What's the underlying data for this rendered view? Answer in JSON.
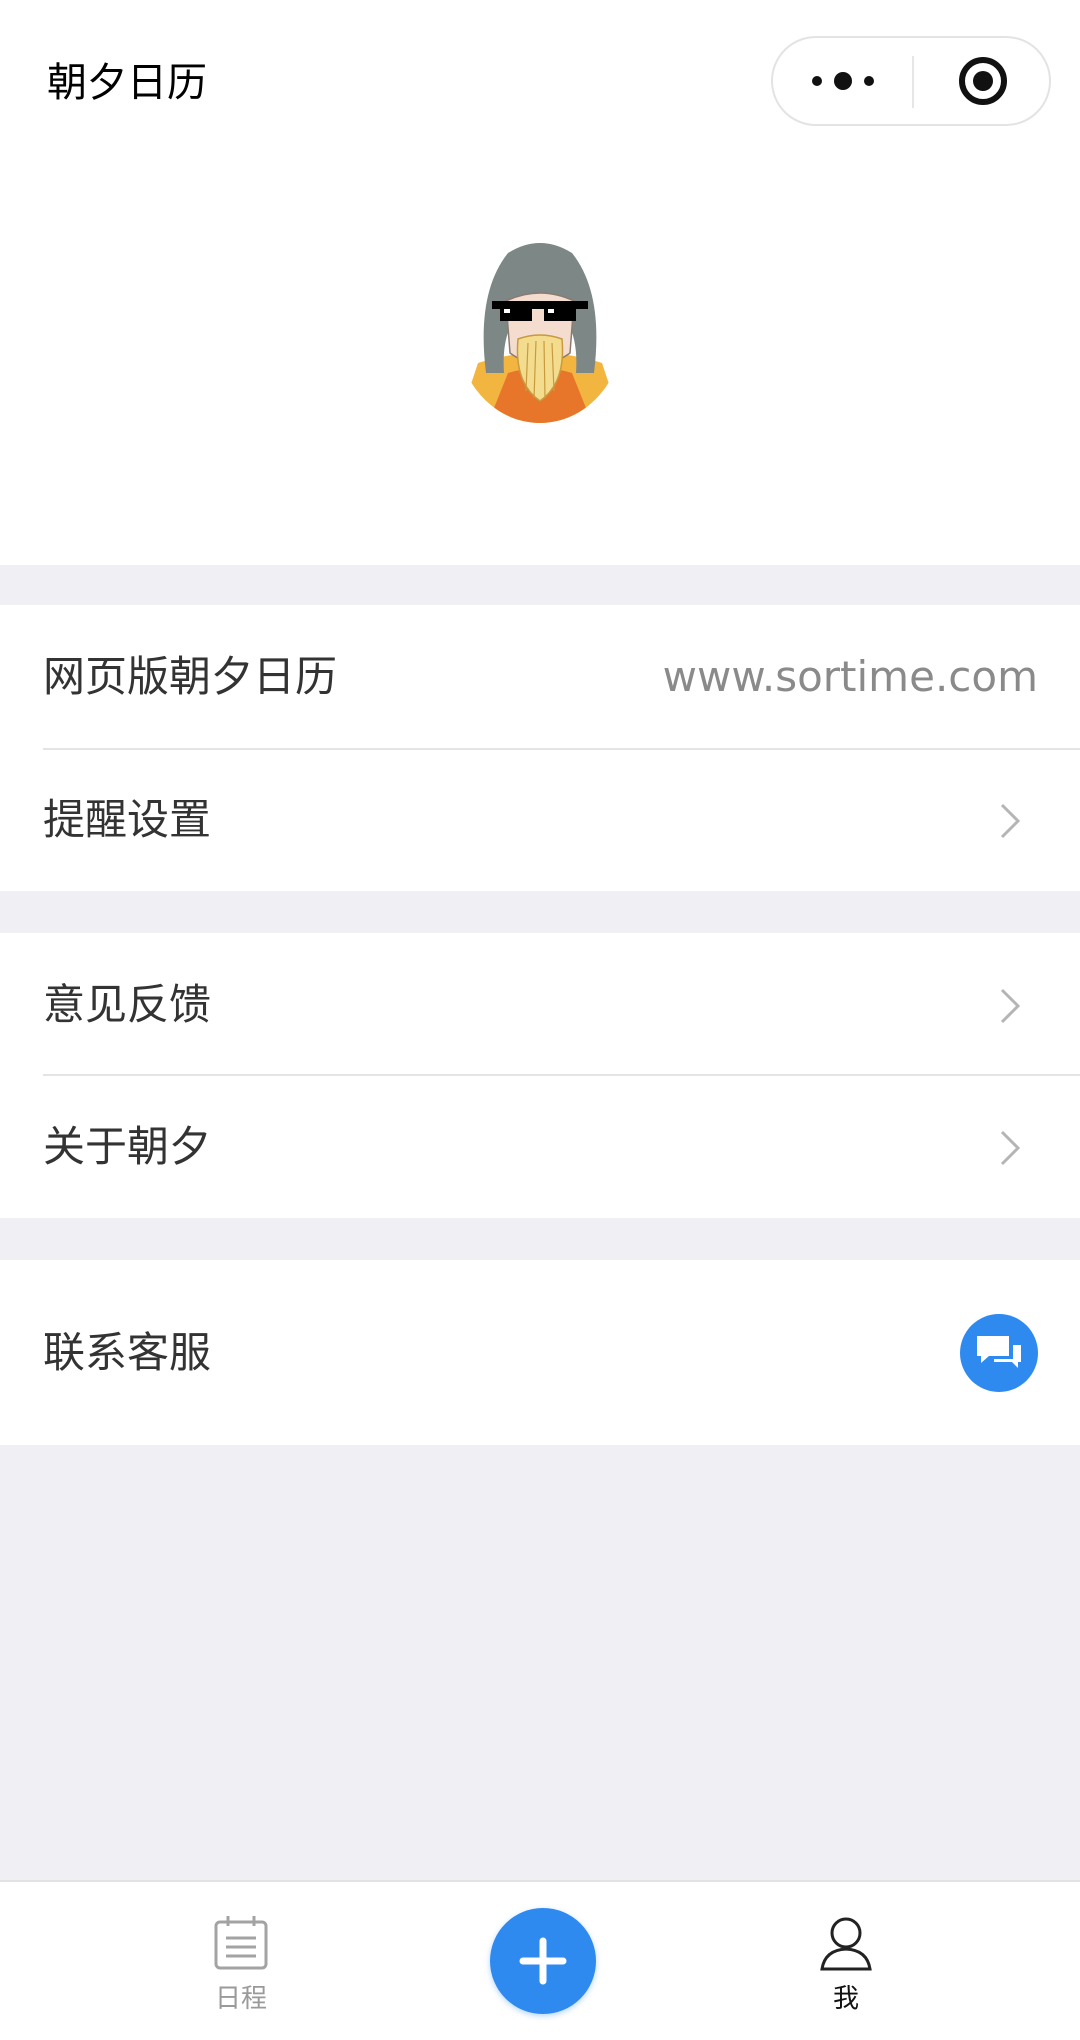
{
  "nav": {
    "title": "朝夕日历",
    "more_icon": "more-dots-icon",
    "close_icon": "target-circle-icon"
  },
  "profile": {
    "avatar_icon": "user-avatar-cartoon"
  },
  "menu": {
    "web": {
      "label": "网页版朝夕日历",
      "value": "www.sortime.com"
    },
    "reminder": {
      "label": "提醒设置"
    },
    "feedback": {
      "label": "意见反馈"
    },
    "about": {
      "label": "关于朝夕"
    },
    "support": {
      "label": "联系客服",
      "icon": "chat-bubbles-icon"
    }
  },
  "tabbar": {
    "schedule_label": "日程",
    "me_label": "我",
    "add_icon": "plus-icon"
  },
  "colors": {
    "accent": "#2f8af0",
    "background": "#efeff4",
    "text": "#333333",
    "muted": "#8a8a8a"
  }
}
